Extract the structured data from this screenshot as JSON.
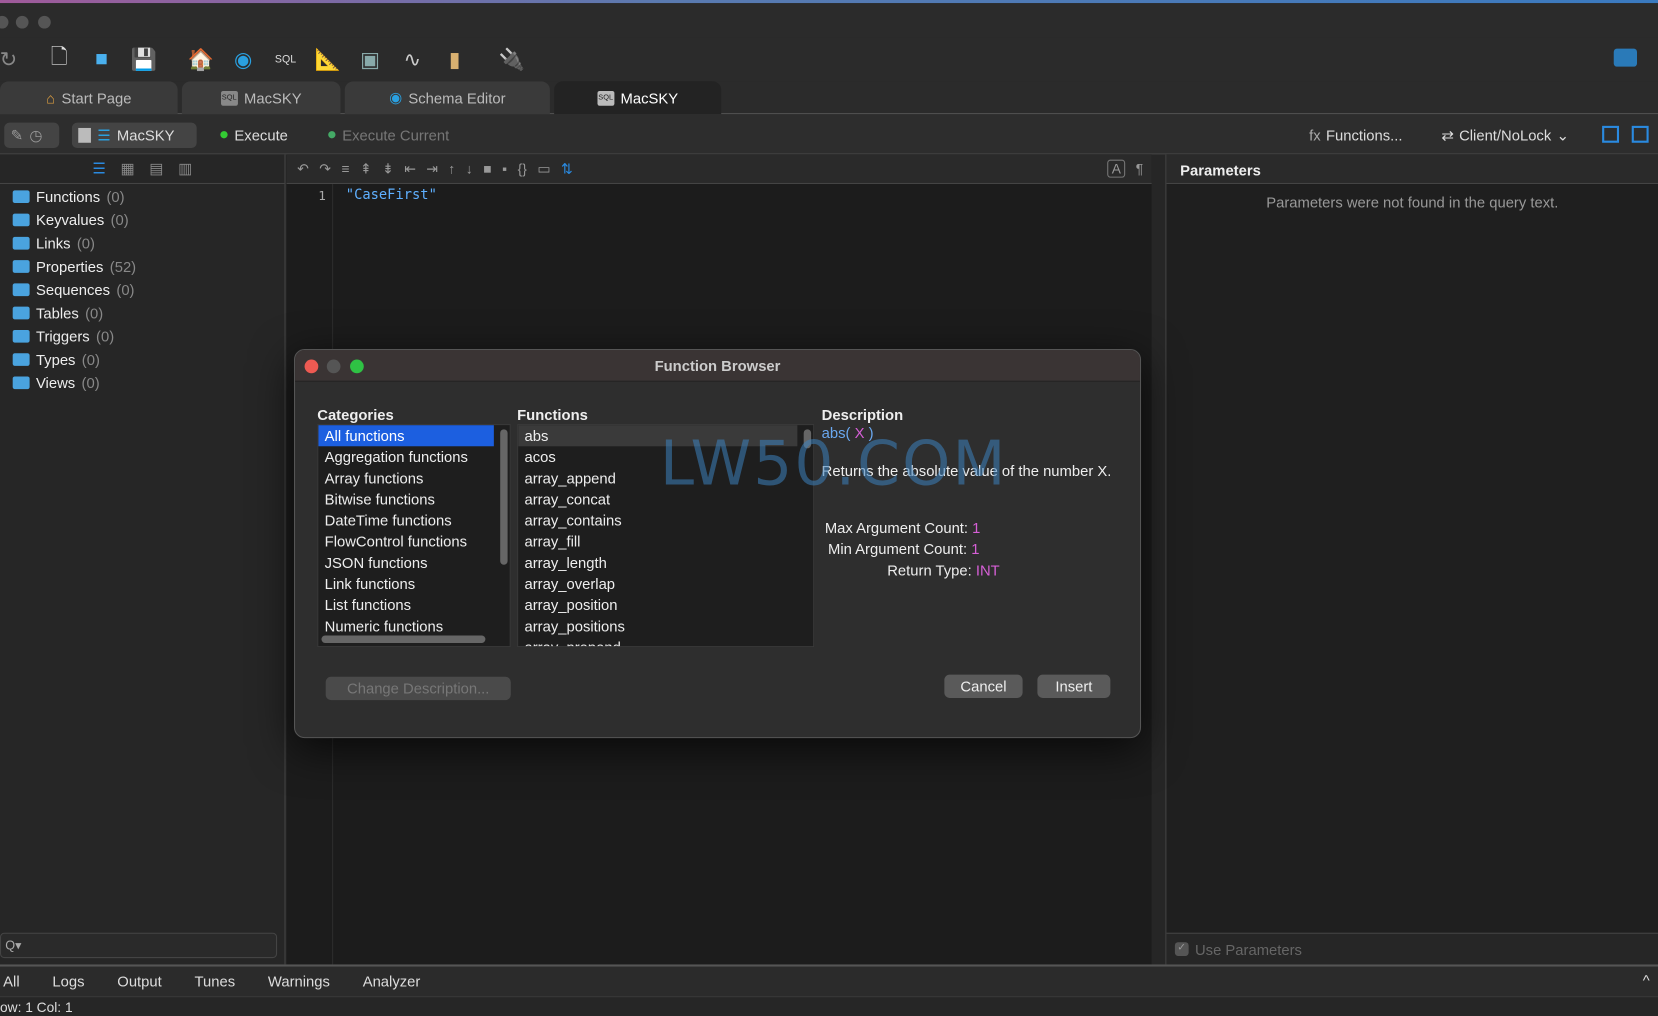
{
  "toolbar": {
    "icons": [
      "refresh-icon",
      "new-file-icon",
      "open-folder-icon",
      "save-icon",
      "home-icon",
      "schema-icon",
      "sql-icon",
      "ruler-icon",
      "layout-icon",
      "monitor-icon",
      "book-icon",
      "plug-icon"
    ]
  },
  "tabs": [
    {
      "label": "Start Page",
      "icon": "home-icon"
    },
    {
      "label": "MacSKY",
      "icon": "sql-icon"
    },
    {
      "label": "Schema Editor",
      "icon": "schema-icon"
    },
    {
      "label": "MacSKY",
      "icon": "sql-icon",
      "active": true
    }
  ],
  "querybar": {
    "connection": "MacSKY",
    "execute": "Execute",
    "execute_current": "Execute Current",
    "functions": "Functions...",
    "lock_mode": "Client/NoLock"
  },
  "tree": [
    {
      "label": "Functions",
      "count": "(0)"
    },
    {
      "label": "Keyvalues",
      "count": "(0)"
    },
    {
      "label": "Links",
      "count": "(0)"
    },
    {
      "label": "Properties",
      "count": "(52)"
    },
    {
      "label": "Sequences",
      "count": "(0)"
    },
    {
      "label": "Tables",
      "count": "(0)"
    },
    {
      "label": "Triggers",
      "count": "(0)"
    },
    {
      "label": "Types",
      "count": "(0)"
    },
    {
      "label": "Views",
      "count": "(0)"
    }
  ],
  "search": {
    "placeholder": "Q▾"
  },
  "editor": {
    "line": "1",
    "code": "\"CaseFirst\""
  },
  "parameters": {
    "title": "Parameters",
    "empty": "Parameters were not found in the query text.",
    "use_parameters": "Use Parameters"
  },
  "bottom_tabs": [
    "All",
    "Logs",
    "Output",
    "Tunes",
    "Warnings",
    "Analyzer"
  ],
  "status": "ow: 1  Col: 1",
  "dialog": {
    "title": "Function Browser",
    "categories_label": "Categories",
    "functions_label": "Functions",
    "description_label": "Description",
    "categories": [
      "All functions",
      "Aggregation functions",
      "Array functions",
      "Bitwise functions",
      "DateTime functions",
      "FlowControl functions",
      "JSON functions",
      "Link functions",
      "List functions",
      "Numeric functions"
    ],
    "functions": [
      "abs",
      "acos",
      "array_append",
      "array_concat",
      "array_contains",
      "array_fill",
      "array_length",
      "array_overlap",
      "array_position",
      "array_positions",
      "array_prepend"
    ],
    "signature_name": "abs(",
    "signature_arg": " X ",
    "signature_close": ")",
    "description": "Returns the absolute value of the number X.",
    "max_label": "Max Argument Count:",
    "max_value": "1",
    "min_label": "Min Argument Count:",
    "min_value": "1",
    "ret_label": "Return Type:",
    "ret_value": "INT",
    "change_description": "Change Description...",
    "cancel": "Cancel",
    "insert": "Insert",
    "watermark": "LW50.COM"
  },
  "colors": {
    "accent": "#1c5fe0",
    "code": "#5fb0ff",
    "value": "#d65fd6"
  }
}
